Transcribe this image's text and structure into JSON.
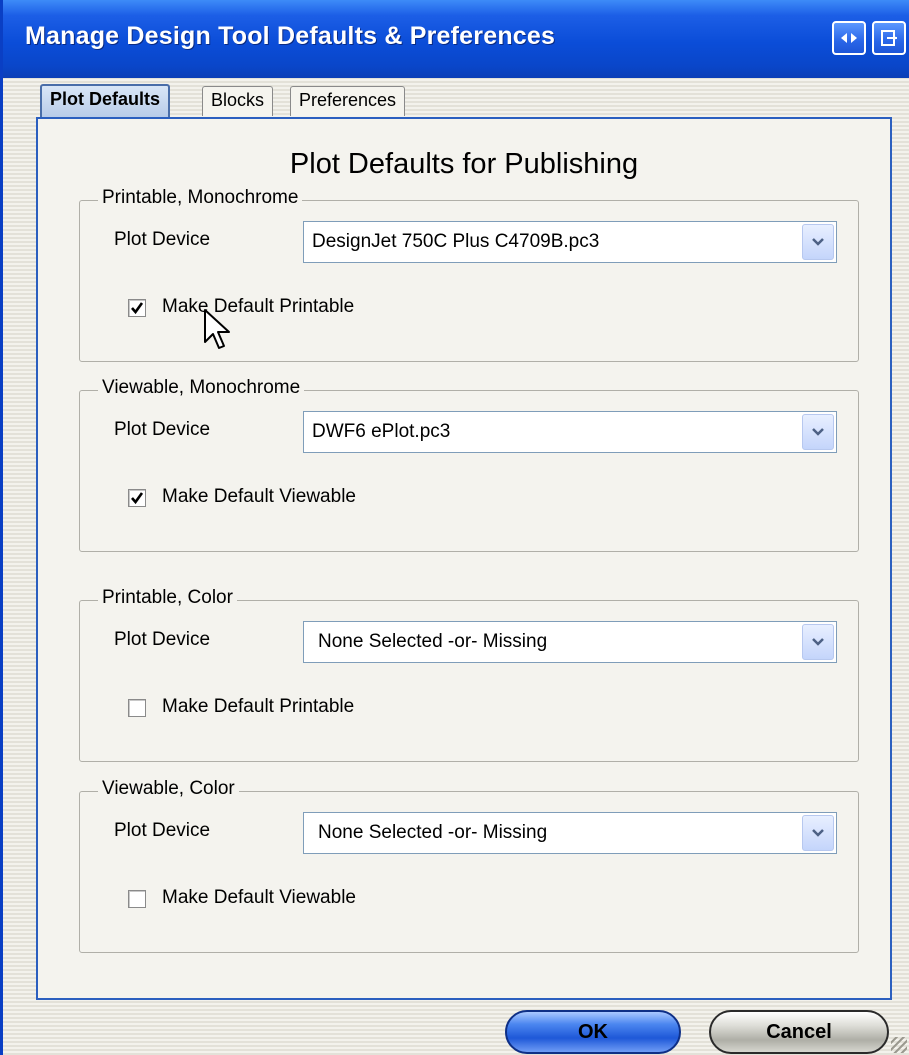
{
  "window": {
    "title": "Manage Design Tool Defaults & Preferences",
    "titlebar_buttons": [
      {
        "icon": "arrows-left-right-icon",
        "glyph": "◂▸"
      },
      {
        "icon": "exit-icon",
        "glyph": "⇥"
      }
    ]
  },
  "tabs": [
    {
      "label": "Plot Defaults",
      "active": true
    },
    {
      "label": "Blocks",
      "active": false
    },
    {
      "label": "Preferences",
      "active": false
    }
  ],
  "panel": {
    "heading": "Plot Defaults for Publishing",
    "groups": [
      {
        "legend": "Printable, Monochrome",
        "field_label": "Plot Device",
        "selected_device": "DesignJet 750C Plus C4709B.pc3",
        "checkbox_label": "Make Default Printable",
        "checked": true
      },
      {
        "legend": "Viewable, Monochrome",
        "field_label": "Plot Device",
        "selected_device": "DWF6 ePlot.pc3",
        "checkbox_label": "Make Default Viewable",
        "checked": true
      },
      {
        "legend": "Printable, Color",
        "field_label": "Plot Device",
        "selected_device": "None Selected -or- Missing",
        "checkbox_label": "Make Default Printable",
        "checked": false
      },
      {
        "legend": "Viewable, Color",
        "field_label": "Plot Device",
        "selected_device": "None Selected -or- Missing",
        "checkbox_label": "Make Default Viewable",
        "checked": false
      }
    ]
  },
  "buttons": {
    "ok_label": "OK",
    "cancel_label": "Cancel"
  },
  "colors": {
    "titlebar": "#0b4dd8",
    "panel_border": "#2b5fbf",
    "ok_button": "#1e58d8"
  }
}
